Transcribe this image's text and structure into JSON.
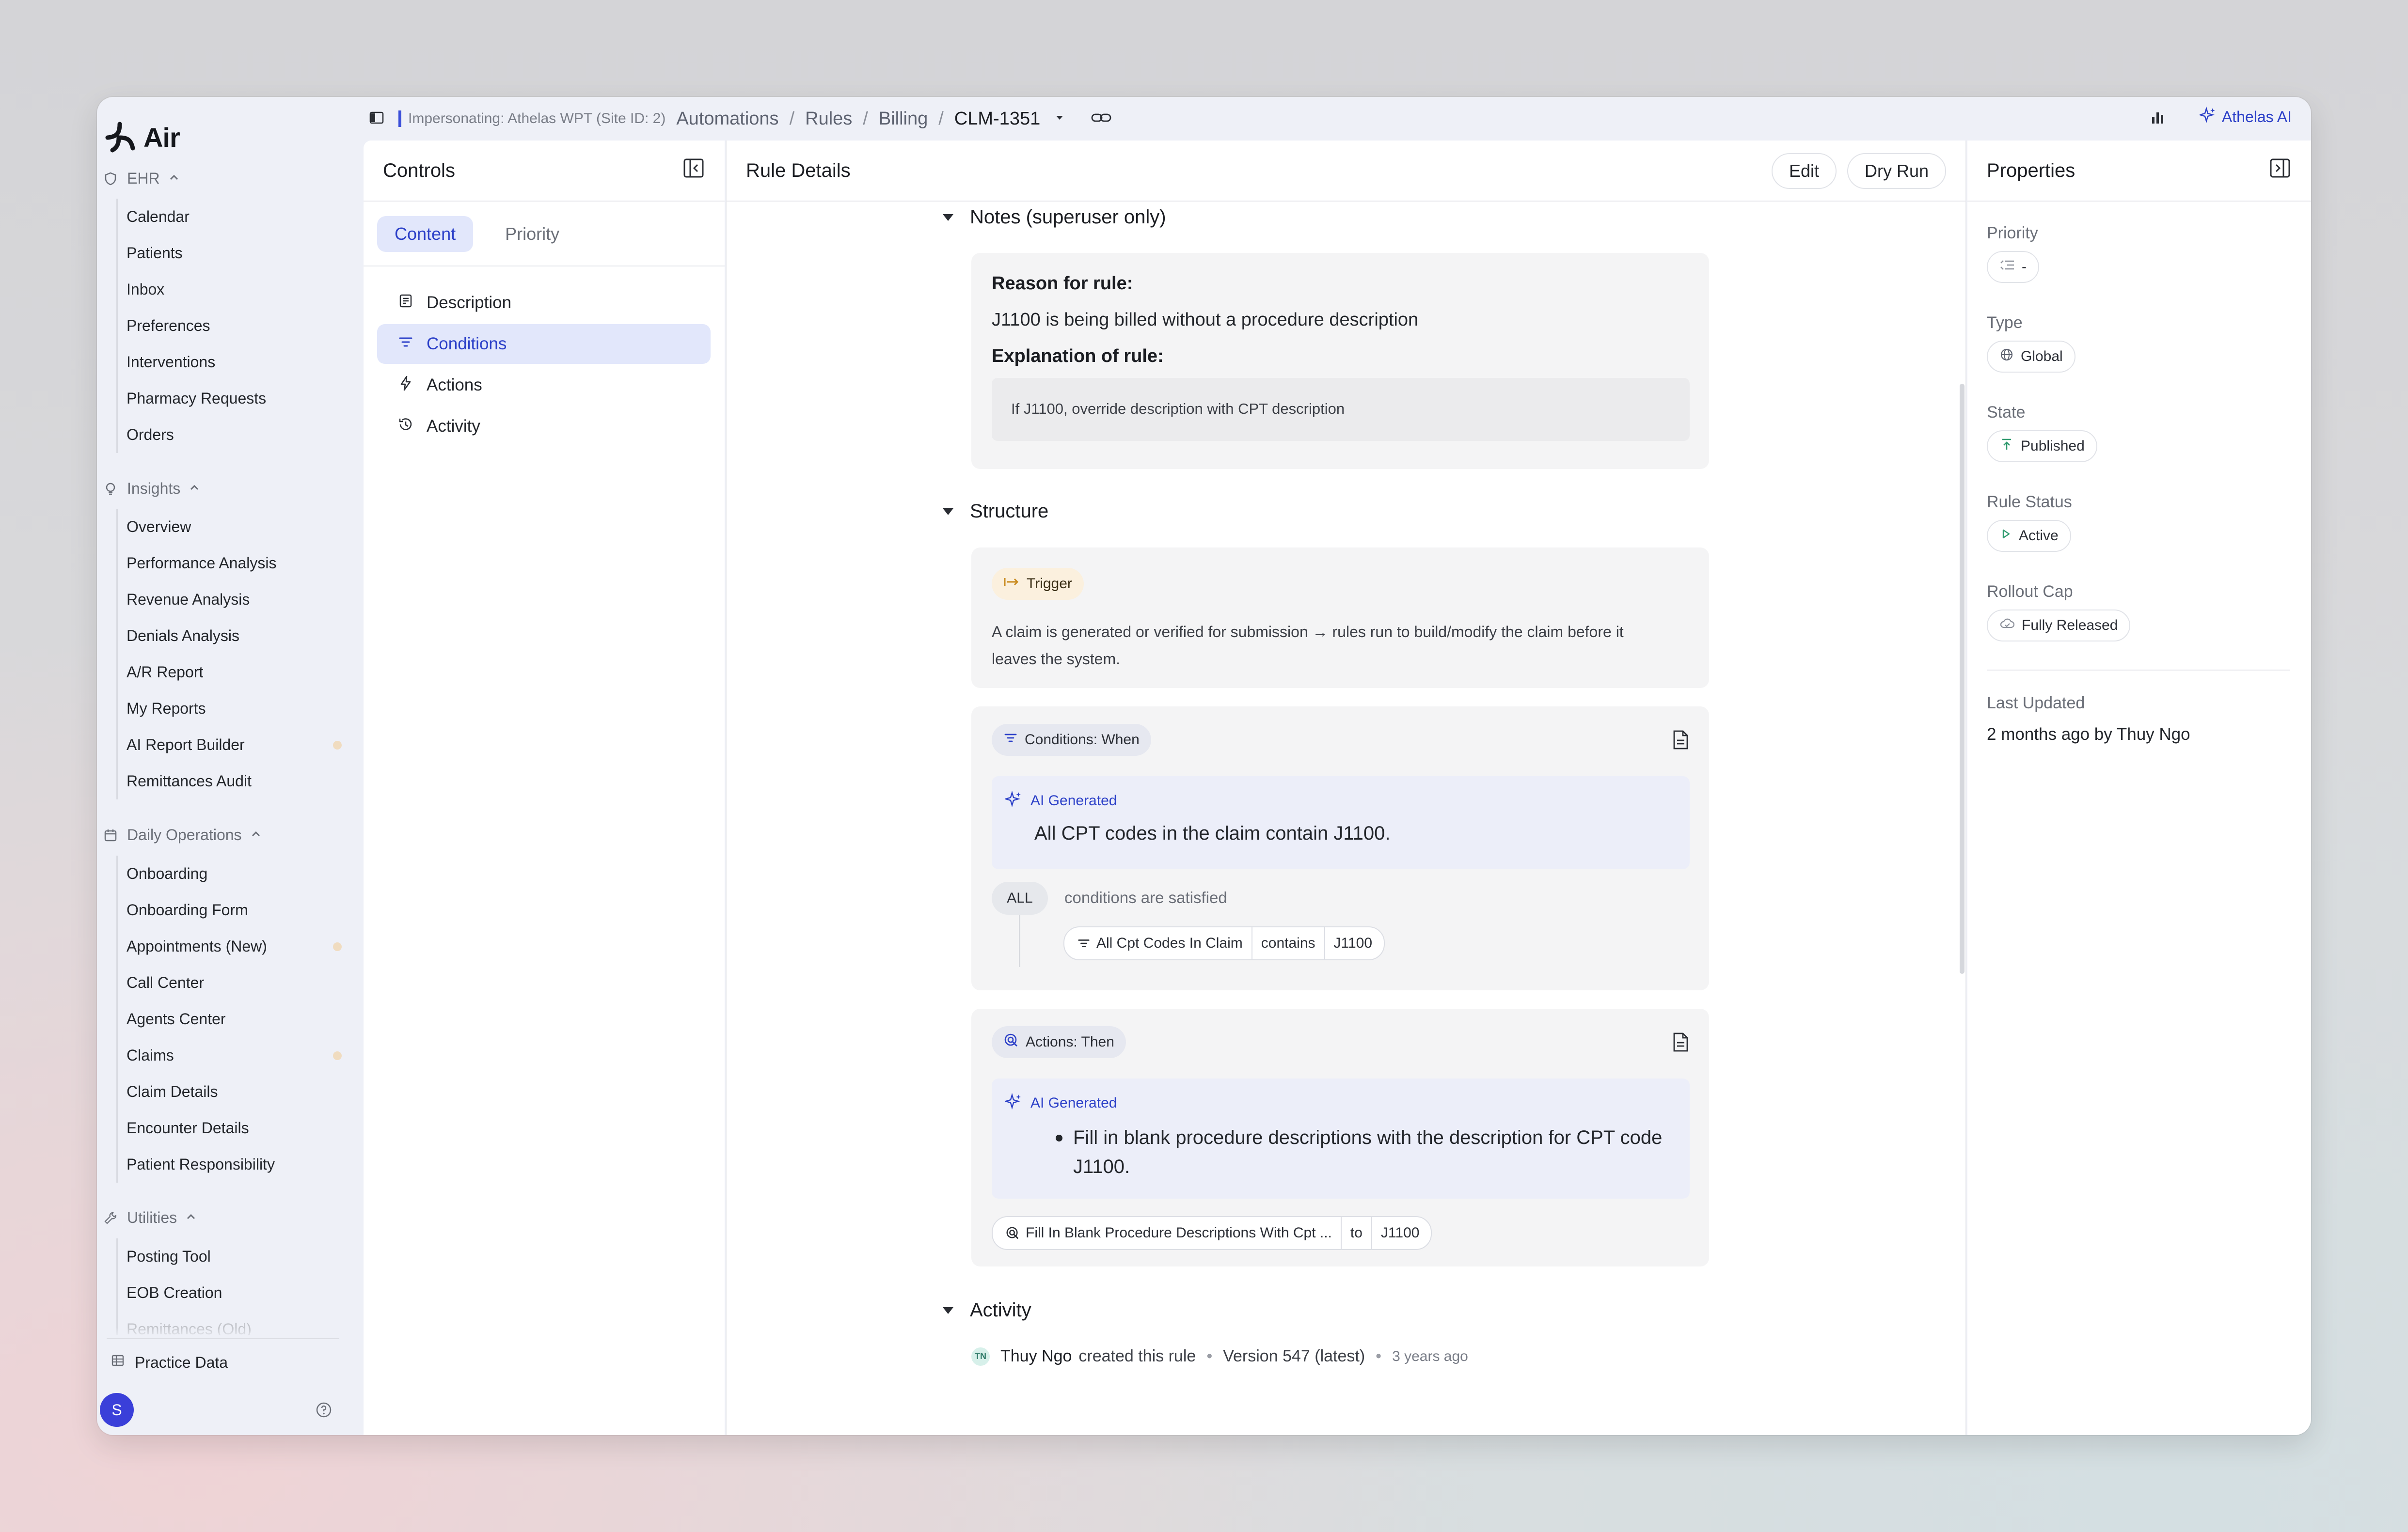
{
  "app": {
    "name": "Air"
  },
  "sidebar": {
    "ehr": {
      "label": "EHR",
      "items": [
        "Calendar",
        "Patients",
        "Inbox",
        "Preferences",
        "Interventions",
        "Pharmacy Requests",
        "Orders"
      ]
    },
    "insights": {
      "label": "Insights",
      "items": [
        "Overview",
        "Performance Analysis",
        "Revenue Analysis",
        "Denials Analysis",
        "A/R Report",
        "My Reports",
        "AI Report Builder",
        "Remittances Audit"
      ]
    },
    "daily_operations": {
      "label": "Daily Operations",
      "items": [
        "Onboarding",
        "Onboarding Form",
        "Appointments (New)",
        "Call Center",
        "Agents Center",
        "Claims",
        "Claim Details",
        "Encounter Details",
        "Patient Responsibility"
      ]
    },
    "utilities": {
      "label": "Utilities",
      "items": [
        "Posting Tool",
        "EOB Creation",
        "Remittances (Old)"
      ]
    },
    "practice_data": "Practice Data",
    "avatar_initial": "S"
  },
  "topbar": {
    "impersonating": "Impersonating: Athelas WPT (Site ID: 2)",
    "breadcrumbs": [
      "Automations",
      "Rules",
      "Billing",
      "CLM-1351"
    ],
    "athelas_ai": "Athelas AI"
  },
  "controls": {
    "title": "Controls",
    "tabs": [
      "Content",
      "Priority"
    ],
    "toc": [
      "Description",
      "Conditions",
      "Actions",
      "Activity"
    ]
  },
  "rule_details": {
    "title": "Rule Details",
    "edit_label": "Edit",
    "dry_run_label": "Dry Run",
    "notes": {
      "title": "Notes (superuser only)",
      "reason_heading": "Reason for rule:",
      "reason_text": "J1100 is being billed without a procedure description",
      "explanation_heading": "Explanation of rule:",
      "explanation_text": "If J1100, override description with CPT description"
    },
    "structure": {
      "title": "Structure",
      "trigger_label": "Trigger",
      "trigger_text_1": "A claim is generated or verified for submission → rules run to build/modify the claim before it",
      "trigger_text_2": "leaves the system.",
      "conditions_label": "Conditions: When",
      "ai_generated": "AI Generated",
      "conditions_summary": "All CPT codes in the claim contain J1100.",
      "all_badge": "ALL",
      "conditions_satisfied": "conditions are satisfied",
      "condition": {
        "field": "All Cpt Codes In Claim",
        "operator": "contains",
        "value": "J1100"
      },
      "actions_label": "Actions: Then",
      "actions_summary_1": "Fill in blank procedure descriptions with the description for CPT code",
      "actions_summary_2": "J1100.",
      "action": {
        "field": "Fill In Blank Procedure Descriptions With Cpt ...",
        "operator": "to",
        "value": "J1100"
      }
    },
    "activity": {
      "title": "Activity",
      "initials": "TN",
      "user": "Thuy Ngo",
      "action": "created this rule",
      "version": "Version 547 (latest)",
      "time": "3 years ago"
    }
  },
  "properties": {
    "title": "Properties",
    "priority_label": "Priority",
    "priority_value": "-",
    "type_label": "Type",
    "type_value": "Global",
    "state_label": "State",
    "state_value": "Published",
    "rule_status_label": "Rule Status",
    "rule_status_value": "Active",
    "rollout_cap_label": "Rollout Cap",
    "rollout_cap_value": "Fully Released",
    "last_updated_label": "Last Updated",
    "last_updated_value": "2 months ago by Thuy Ngo"
  },
  "colors": {
    "accent": "#2c40c8",
    "window_bg": "#eef0f7",
    "card_bg": "#f4f4f5",
    "ai_bg": "#eceef9",
    "trigger_bg": "#fbf0de",
    "avatar": "#3a3fd9"
  }
}
